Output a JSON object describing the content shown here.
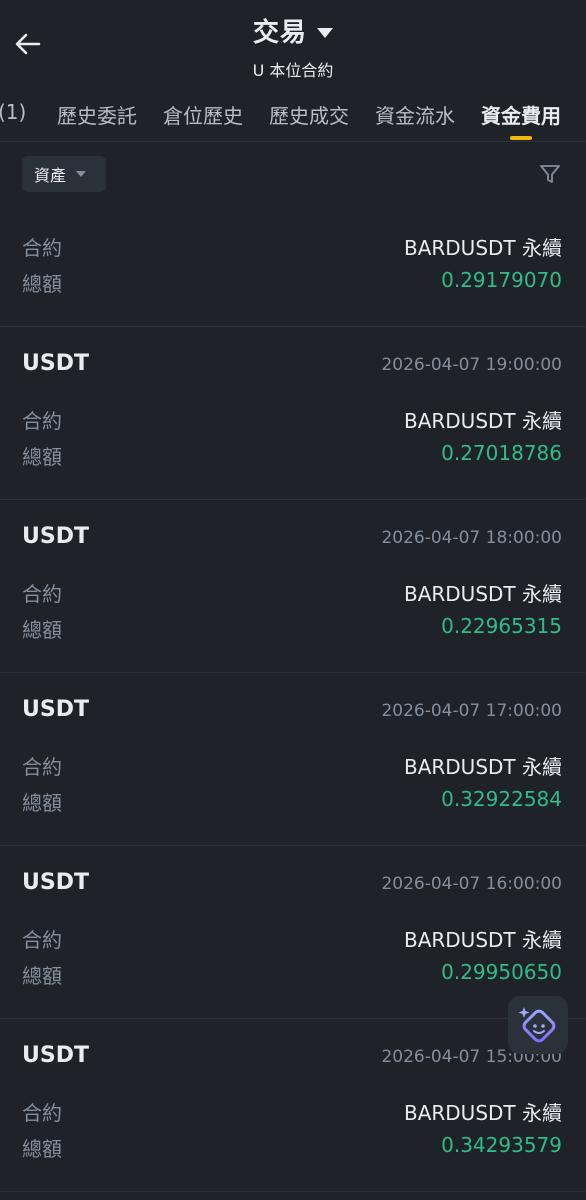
{
  "header": {
    "title": "交易",
    "subtitle": "U 本位合約"
  },
  "tabs": [
    {
      "label": "(1)"
    },
    {
      "label": "歷史委託"
    },
    {
      "label": "倉位歷史"
    },
    {
      "label": "歷史成交"
    },
    {
      "label": "資金流水"
    },
    {
      "label": "資金費用"
    }
  ],
  "filter": {
    "asset_label": "資產"
  },
  "records": [
    {
      "asset": "",
      "time": "",
      "contract_label": "合約",
      "contract": "BARDUSDT 永續",
      "total_label": "總額",
      "total": "0.29179070"
    },
    {
      "asset": "USDT",
      "time": "2026-04-07 19:00:00",
      "contract_label": "合約",
      "contract": "BARDUSDT 永續",
      "total_label": "總額",
      "total": "0.27018786"
    },
    {
      "asset": "USDT",
      "time": "2026-04-07 18:00:00",
      "contract_label": "合約",
      "contract": "BARDUSDT 永續",
      "total_label": "總額",
      "total": "0.22965315"
    },
    {
      "asset": "USDT",
      "time": "2026-04-07 17:00:00",
      "contract_label": "合約",
      "contract": "BARDUSDT 永續",
      "total_label": "總額",
      "total": "0.32922584"
    },
    {
      "asset": "USDT",
      "time": "2026-04-07 16:00:00",
      "contract_label": "合約",
      "contract": "BARDUSDT 永續",
      "total_label": "總額",
      "total": "0.29950650"
    },
    {
      "asset": "USDT",
      "time": "2026-04-07 15:00:00",
      "contract_label": "合約",
      "contract": "BARDUSDT 永續",
      "total_label": "總額",
      "total": "0.34293579"
    }
  ],
  "colors": {
    "background": "#1f2229",
    "accent": "#f0b90b",
    "positive": "#2ebd85",
    "muted": "#848e9c"
  },
  "icons": {
    "back": "arrow-left-icon",
    "title_dropdown": "caret-down-icon",
    "asset_dropdown": "caret-down-icon",
    "filter": "filter-icon",
    "assistant": "ai-assistant-icon"
  }
}
